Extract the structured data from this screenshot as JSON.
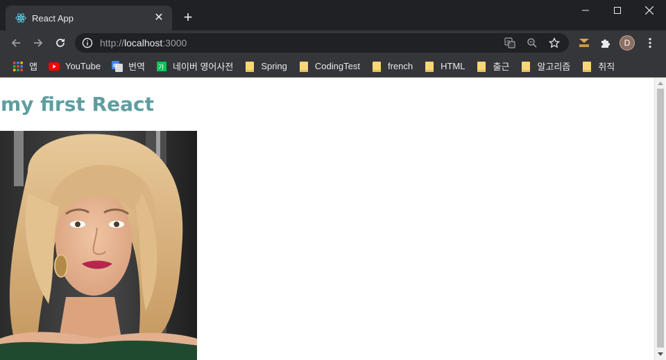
{
  "tab": {
    "title": "React App",
    "favicon": "react-icon"
  },
  "toolbar": {
    "url_scheme": "http://",
    "url_host": "localhost",
    "url_port": ":3000"
  },
  "bookmarks": [
    {
      "label": "앱",
      "icon": "apps-grid-icon"
    },
    {
      "label": "YouTube",
      "icon": "youtube-icon"
    },
    {
      "label": "번역",
      "icon": "google-translate-icon"
    },
    {
      "label": "네이버 영어사전",
      "icon": "naver-dictionary-icon"
    },
    {
      "label": "Spring",
      "icon": "folder-icon"
    },
    {
      "label": "CodingTest",
      "icon": "folder-icon"
    },
    {
      "label": "french",
      "icon": "folder-icon"
    },
    {
      "label": "HTML",
      "icon": "folder-icon"
    },
    {
      "label": "출근",
      "icon": "folder-icon"
    },
    {
      "label": "알고리즘",
      "icon": "folder-icon"
    },
    {
      "label": "취직",
      "icon": "folder-icon"
    }
  ],
  "profile": {
    "initial": "D"
  },
  "page": {
    "heading": "my first React",
    "heading_color": "#5f9ea0"
  }
}
